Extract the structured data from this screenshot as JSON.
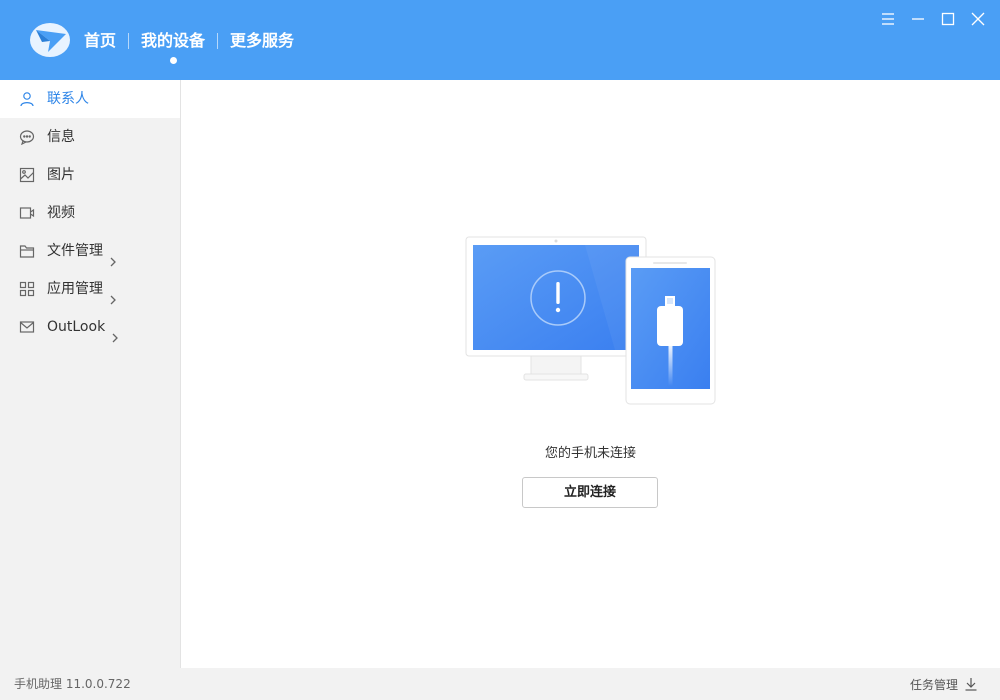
{
  "header": {
    "tabs": [
      {
        "label": "首页"
      },
      {
        "label": "我的设备"
      },
      {
        "label": "更多服务"
      }
    ],
    "active_tab": "我的设备",
    "accent_color": "#4a9ff5"
  },
  "sidebar": {
    "items": [
      {
        "label": "联系人",
        "icon": "person-icon",
        "active": true
      },
      {
        "label": "信息",
        "icon": "message-bubble-icon"
      },
      {
        "label": "图片",
        "icon": "image-icon"
      },
      {
        "label": "视频",
        "icon": "video-icon"
      },
      {
        "label": "文件管理",
        "icon": "folder-icon",
        "expandable": true
      },
      {
        "label": "应用管理",
        "icon": "apps-grid-icon",
        "expandable": true
      },
      {
        "label": "OutLook",
        "icon": "mail-icon",
        "expandable": true
      }
    ],
    "active_color": "#2f86e8"
  },
  "main": {
    "status_text": "您的手机未连接",
    "connect_button": "立即连接"
  },
  "footer": {
    "version": "手机助理 11.0.0.722",
    "task_manager": "任务管理"
  }
}
